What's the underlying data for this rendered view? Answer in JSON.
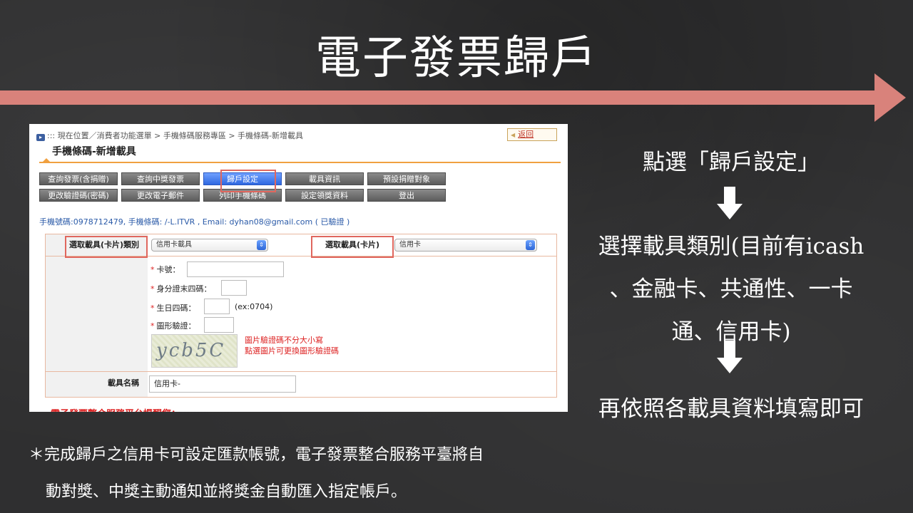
{
  "slide": {
    "title": "電子發票歸戶",
    "right_text": {
      "step1": "點選「歸戶設定」",
      "step2_line1": "選擇載具類別(目前有icash",
      "step2_line2": "、金融卡、共通性、一卡",
      "step2_line3": "通、信用卡)",
      "step3": "再依照各載具資料填寫即可"
    },
    "note_line1": "＊完成歸戶之信用卡可設定匯款帳號，電子發票整合服務平臺將自",
    "note_line2": "動對獎、中獎主動通知並將獎金自動匯入指定帳戶。",
    "colors": {
      "accent_arrow": "#d9827b",
      "highlight_box": "#e0675e",
      "active_tab": "#2f68e0"
    }
  },
  "screenshot": {
    "breadcrumb": ":::  現在位置／消費者功能選單 > 手機條碼服務專區  > 手機條碼-新增載具",
    "back_label": "返回",
    "page_title": "手機條碼-新增載具",
    "menu_row1": [
      "查詢發票(含捐贈)",
      "查詢中獎發票",
      "歸戶設定",
      "載具資訊",
      "預設捐贈對象"
    ],
    "menu_row2": [
      "更改驗證碼(密碼)",
      "更改電子郵件",
      "列印手機條碼",
      "設定領獎資料",
      "登出"
    ],
    "user_info": "手機號碼:0978712479, 手機條碼: /-L.ITVR , Email: dyhan08@gmail.com ( 已驗證 )",
    "carrier_type_label": "選取載具(卡片)類別",
    "carrier_type_value": "信用卡載具",
    "carrier_card_label": "選取載具(卡片)",
    "carrier_card_value": "信用卡",
    "fields": {
      "card_no": "卡號：",
      "id_last4": "身分證末四碼：",
      "birthday": "生日四碼：",
      "birthday_hint": "(ex:0704)",
      "captcha": "圖形驗證："
    },
    "captcha_text": "ycb5C",
    "captcha_note_line1": "圖片驗證碼不分大小寫",
    "captcha_note_line2": "點選圖片可更換圖形驗證碼",
    "carrier_name_label": "載具名稱",
    "carrier_name_value": "信用卡-",
    "cut_off_text": "電子發票整合服務平台提醒您："
  }
}
